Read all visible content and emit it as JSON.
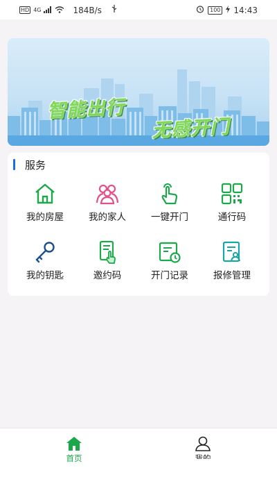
{
  "status_bar": {
    "hd": "HD",
    "net_type": "4G",
    "speed": "184B/s",
    "battery": "100",
    "time": "14:43"
  },
  "banner": {
    "slogan_1": "智能出行",
    "slogan_2": "无感开门"
  },
  "services": {
    "title": "服务",
    "items": [
      {
        "label": "我的房屋",
        "icon": "house-icon",
        "color": "#1aa84a"
      },
      {
        "label": "我的家人",
        "icon": "family-icon",
        "color": "#e2508a"
      },
      {
        "label": "一键开门",
        "icon": "tap-hand-icon",
        "color": "#1aa84a"
      },
      {
        "label": "通行码",
        "icon": "qr-code-icon",
        "color": "#1aa84a"
      },
      {
        "label": "我的钥匙",
        "icon": "key-icon",
        "color": "#1d4f8f"
      },
      {
        "label": "邀约码",
        "icon": "invite-card-icon",
        "color": "#1aa84a"
      },
      {
        "label": "开门记录",
        "icon": "door-record-icon",
        "color": "#1aa84a"
      },
      {
        "label": "报修管理",
        "icon": "repair-doc-icon",
        "color": "#1aa3a3"
      }
    ]
  },
  "bottom_nav": {
    "home": {
      "label": "首页",
      "icon": "home-icon",
      "active": true
    },
    "mine": {
      "label": "我的",
      "icon": "user-icon",
      "active": false
    }
  },
  "colors": {
    "accent": "#1aa84a",
    "section_bar": "#1b6fe0",
    "background": "#f5f3f6"
  }
}
